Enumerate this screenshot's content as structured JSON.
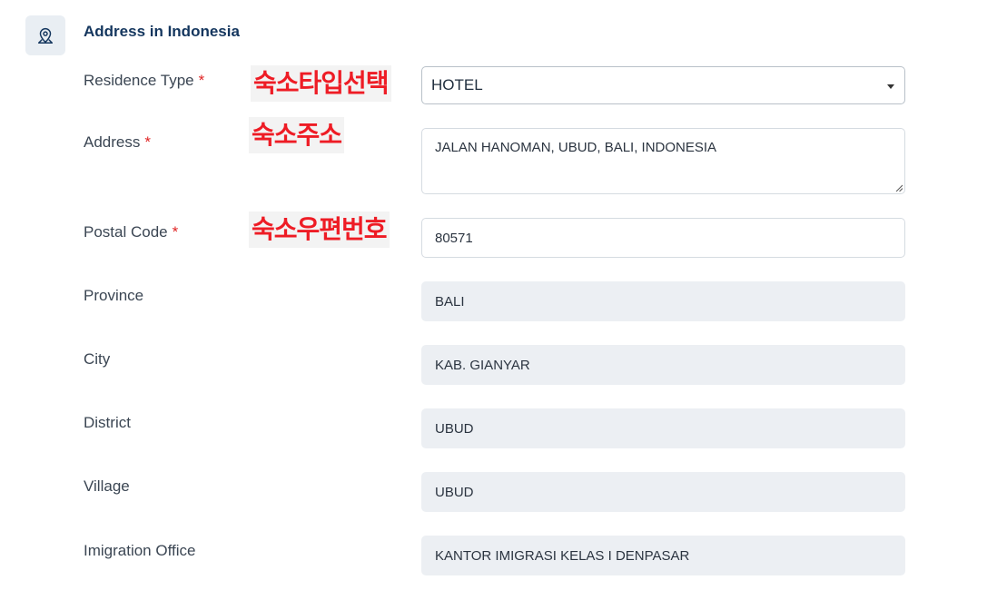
{
  "section": {
    "title": "Address in Indonesia",
    "icon": "map-pin-icon"
  },
  "annotations": {
    "residence_type": "숙소타입선택",
    "address": "숙소주소",
    "postal_code": "숙소우편번호"
  },
  "form": {
    "required_mark": "*",
    "residence_type": {
      "label": "Residence Type",
      "value": "HOTEL"
    },
    "address": {
      "label": "Address",
      "value": "JALAN HANOMAN, UBUD, BALI, INDONESIA"
    },
    "postal_code": {
      "label": "Postal Code",
      "value": "80571"
    },
    "province": {
      "label": "Province",
      "value": "BALI"
    },
    "city": {
      "label": "City",
      "value": "KAB. GIANYAR"
    },
    "district": {
      "label": "District",
      "value": "UBUD"
    },
    "village": {
      "label": "Village",
      "value": "UBUD"
    },
    "immigration_office": {
      "label": "Imigration Office",
      "value": "KANTOR IMIGRASI KELAS I DENPASAR"
    }
  },
  "colors": {
    "title": "#14365e",
    "required": "#e02424",
    "annotation": "#ee1c25",
    "readonly_bg": "#eceff3"
  }
}
